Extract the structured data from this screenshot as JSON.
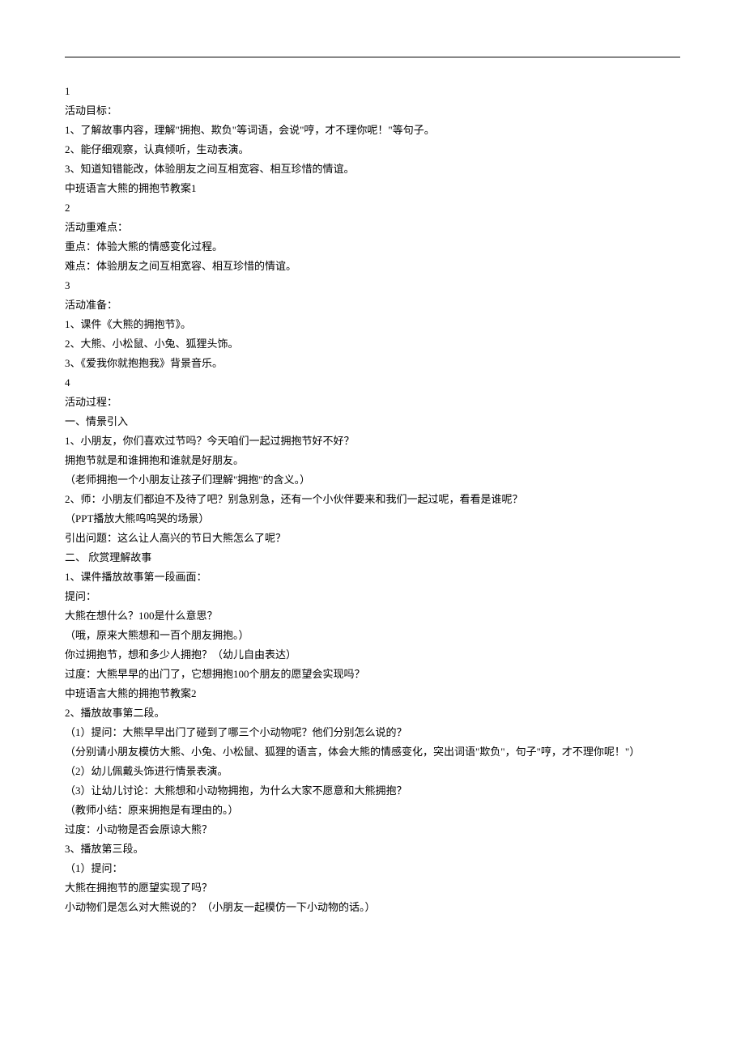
{
  "lines": [
    "1",
    "活动目标：",
    "1、了解故事内容，理解\"拥抱、欺负\"等词语，会说\"哼，才不理你呢！\"等句子。",
    "2、能仔细观察，认真倾听，生动表演。",
    "3、知道知错能改，体验朋友之间互相宽容、相互珍惜的情谊。",
    "中班语言大熊的拥抱节教案1",
    "2",
    "活动重难点：",
    "重点：体验大熊的情感变化过程。",
    "难点：体验朋友之间互相宽容、相互珍惜的情谊。",
    "3",
    "活动准备：",
    "1、课件《大熊的拥抱节》。",
    "2、大熊、小松鼠、小兔、狐狸头饰。",
    "3、《爱我你就抱抱我》背景音乐。",
    "4",
    "活动过程：",
    "一、情景引入",
    "1、小朋友，你们喜欢过节吗？今天咱们一起过拥抱节好不好？",
    "拥抱节就是和谁拥抱和谁就是好朋友。",
    "（老师拥抱一个小朋友让孩子们理解\"拥抱\"的含义。）",
    "2、师：小朋友们都迫不及待了吧？别急别急，还有一个小伙伴要来和我们一起过呢，看看是谁呢？",
    "（PPT播放大熊呜呜哭的场景）",
    "引出问题：这么让人高兴的节日大熊怎么了呢？",
    "二、 欣赏理解故事",
    "1、课件播放故事第一段画面：",
    "提问：",
    "大熊在想什么？100是什么意思？",
    "（哦，原来大熊想和一百个朋友拥抱。）",
    "你过拥抱节，想和多少人拥抱？（幼儿自由表达）",
    "过度：大熊早早的出门了，它想拥抱100个朋友的愿望会实现吗？",
    "中班语言大熊的拥抱节教案2",
    "2、播放故事第二段。",
    "（1）提问：大熊早早出门了碰到了哪三个小动物呢？他们分别怎么说的？",
    "（分别请小朋友模仿大熊、小兔、小松鼠、狐狸的语言，体会大熊的情感变化，突出词语\"欺负\"，句子\"哼，才不理你呢！\"）",
    "（2）幼儿佩戴头饰进行情景表演。",
    "（3）让幼儿讨论：大熊想和小动物拥抱，为什么大家不愿意和大熊拥抱？",
    "（教师小结：原来拥抱是有理由的。）",
    "过度：小动物是否会原谅大熊？",
    "3、播放第三段。",
    "（1）提问：",
    "大熊在拥抱节的愿望实现了吗？",
    "小动物们是怎么对大熊说的？（小朋友一起模仿一下小动物的话。）"
  ]
}
